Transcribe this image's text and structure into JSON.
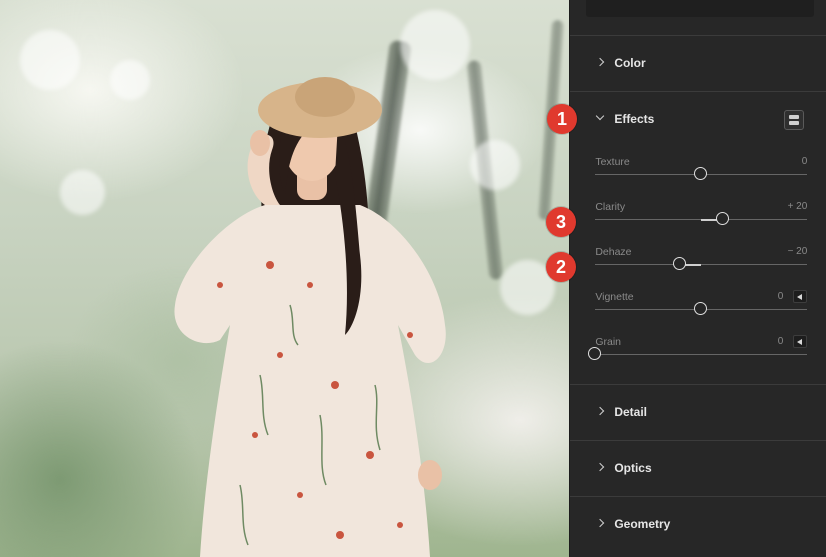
{
  "panel": {
    "sections_collapsed_top": [
      {
        "label": "Color"
      }
    ],
    "effects": {
      "label": "Effects",
      "sliders": [
        {
          "label": "Texture",
          "value_text": "0",
          "value": 0,
          "min": -100,
          "max": 100,
          "has_arrow": false
        },
        {
          "label": "Clarity",
          "value_text": "+ 20",
          "value": 20,
          "min": -100,
          "max": 100,
          "has_arrow": false
        },
        {
          "label": "Dehaze",
          "value_text": "− 20",
          "value": -20,
          "min": -100,
          "max": 100,
          "has_arrow": false
        },
        {
          "label": "Vignette",
          "value_text": "0",
          "value": 0,
          "min": -100,
          "max": 100,
          "has_arrow": true
        },
        {
          "label": "Grain",
          "value_text": "0",
          "value": 0,
          "min": 0,
          "max": 100,
          "has_arrow": true
        }
      ]
    },
    "sections_collapsed_bottom": [
      {
        "label": "Detail"
      },
      {
        "label": "Optics"
      },
      {
        "label": "Geometry"
      }
    ]
  },
  "markers": [
    {
      "label": "1"
    },
    {
      "label": "2"
    },
    {
      "label": "3"
    }
  ],
  "colors": {
    "panel_bg": "#272727",
    "marker_red": "#e0392e",
    "text_header": "#e6e6e6",
    "text_label": "#8a8a8a"
  },
  "icons": {
    "section_expanded": "chevron-down-icon",
    "section_collapsed": "chevron-right-icon",
    "view_mode": "panel-mode-icon",
    "slider_menu": "triangle-left-icon"
  }
}
